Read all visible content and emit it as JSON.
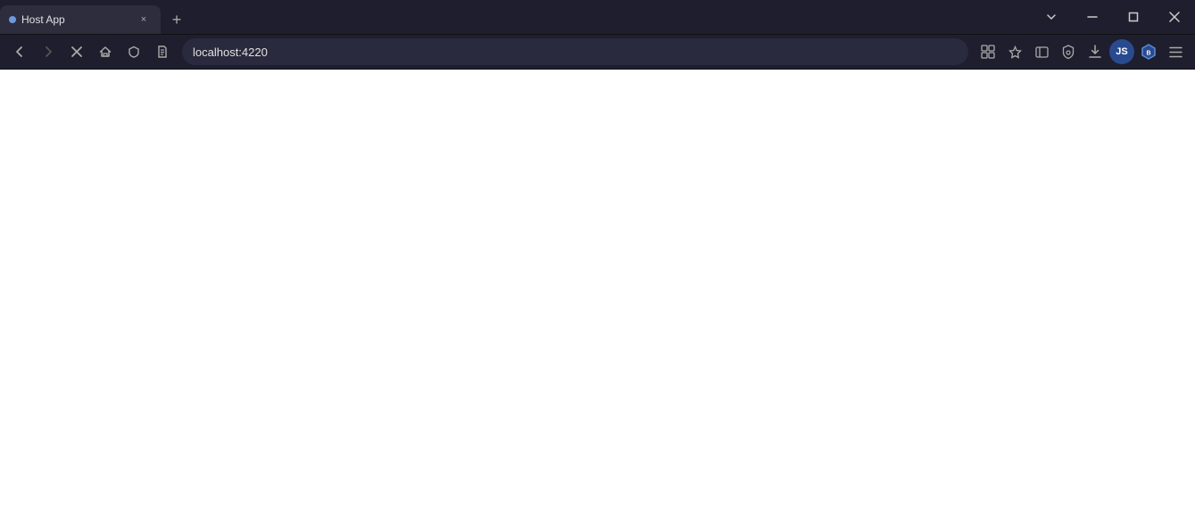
{
  "titleBar": {
    "tab": {
      "title": "Host App",
      "favicon_color": "#6b9bdf",
      "close_label": "×"
    },
    "newTab": {
      "label": "+"
    },
    "windowControls": {
      "minimize": "—",
      "maximize": "□",
      "close": "✕",
      "dropdown": "⌄"
    }
  },
  "navBar": {
    "back_title": "Back",
    "forward_title": "Forward",
    "stop_title": "Stop",
    "home_title": "Home",
    "shield_title": "Shield",
    "page_title": "Page",
    "address": "localhost:4220",
    "icons": {
      "extensions": "⊞",
      "bookmark": "☆",
      "sidebar": "⊟",
      "shield": "◎",
      "download": "⬇",
      "profile": "JS",
      "brave": "B",
      "menu": "≡"
    }
  }
}
